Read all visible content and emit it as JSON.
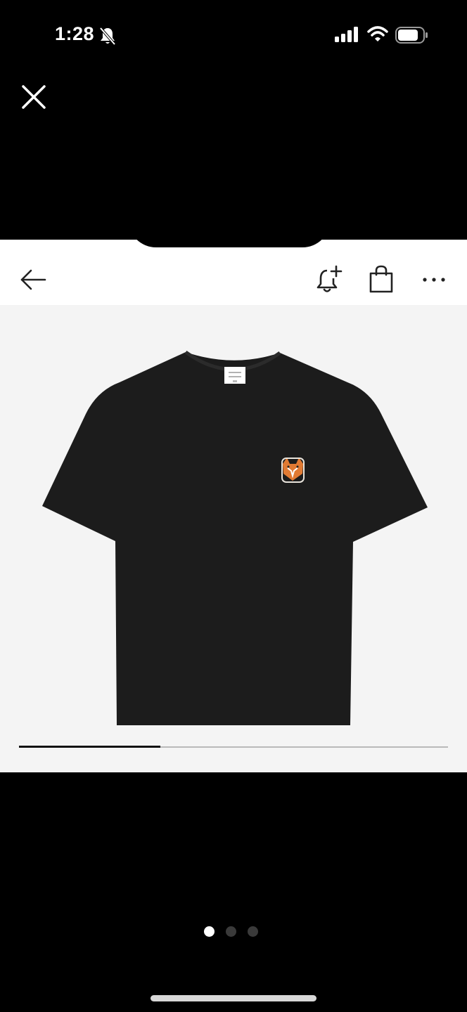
{
  "status_bar": {
    "time": "1:28",
    "icons": [
      "bell-slash-icon",
      "cellular-signal-icon",
      "wifi-icon",
      "battery-icon"
    ]
  },
  "viewer": {
    "close_icon": "close-icon",
    "page_dots": {
      "count": 3,
      "active_index": 0
    }
  },
  "product_page": {
    "toolbar_icons": [
      "back-arrow-icon",
      "bell-plus-icon",
      "shopping-bag-icon",
      "more-horizontal-icon"
    ],
    "image": {
      "subject": "tshirt-icon",
      "garment_color": "#1c1c1c",
      "background_color": "#f4f4f4"
    },
    "gallery_progress": 0.33
  }
}
